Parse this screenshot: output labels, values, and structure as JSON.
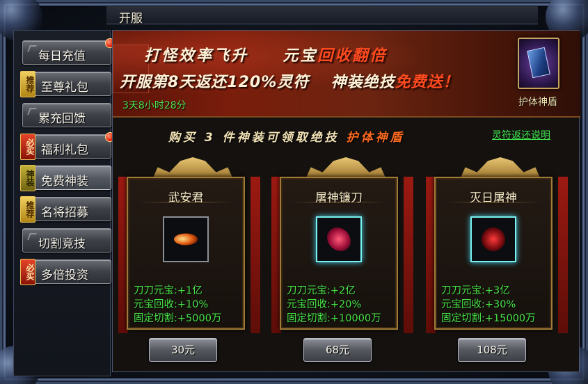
{
  "window": {
    "title": "开服"
  },
  "sidebar": {
    "items": [
      {
        "label": "每日充值",
        "badge": "",
        "has_dot": true
      },
      {
        "label": "至尊礼包",
        "badge": "推荐",
        "has_dot": false
      },
      {
        "label": "累充回馈",
        "badge": "",
        "has_dot": false
      },
      {
        "label": "福利礼包",
        "badge": "必买",
        "has_dot": true
      },
      {
        "label": "免费神装",
        "badge": "神装",
        "has_dot": false,
        "active": true
      },
      {
        "label": "名将招募",
        "badge": "推荐",
        "has_dot": false
      },
      {
        "label": "切割竞技",
        "badge": "",
        "has_dot": false
      },
      {
        "label": "多倍投资",
        "badge": "必买",
        "has_dot": false
      }
    ]
  },
  "banner": {
    "line1_a": "打怪效率飞升",
    "line1_b": "元宝",
    "line1_c": "回收翻倍",
    "line2_a": "开服第8天返还120%灵符",
    "line2_b": "神装绝技",
    "line2_c": "免费送！",
    "countdown": "3天8小时28分",
    "reward_label": "护体神盾",
    "reward_icon": "skill-book-icon"
  },
  "subtitle": {
    "prefix": "购买 3 件神装可领取绝技",
    "highlight": "护体神盾"
  },
  "explain_link": "灵符返还说明",
  "cards": [
    {
      "name": "武安君",
      "icon": "flaming-blade-icon",
      "stats": [
        "刀刀元宝:+1亿",
        "元宝回收:+10%",
        "固定切割:+5000万"
      ],
      "price": "30元"
    },
    {
      "name": "屠神镰刀",
      "icon": "scythe-icon",
      "stats": [
        "刀刀元宝:+2亿",
        "元宝回收:+20%",
        "固定切割:+10000万"
      ],
      "price": "68元"
    },
    {
      "name": "灭日屠神",
      "icon": "demon-armor-icon",
      "stats": [
        "刀刀元宝:+3亿",
        "元宝回收:+30%",
        "固定切割:+15000万"
      ],
      "price": "108元"
    }
  ],
  "colors": {
    "accent_green": "#48e648",
    "highlight_red": "#ff4a20",
    "gold_border": "#a07a36"
  }
}
